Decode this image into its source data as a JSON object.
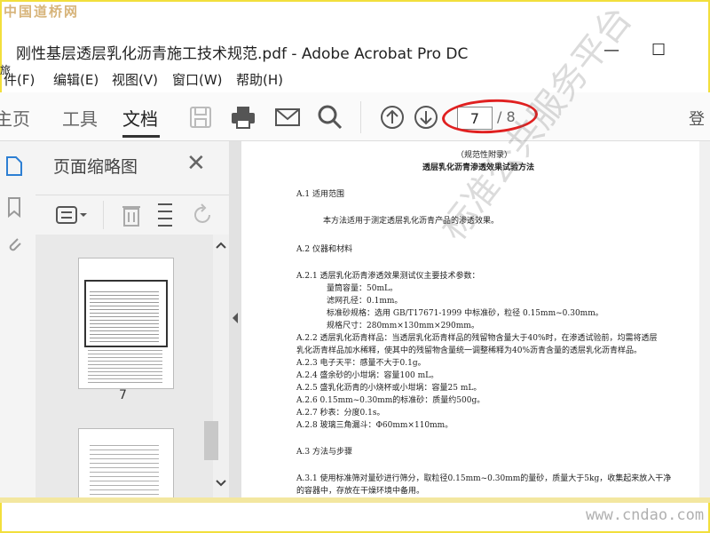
{
  "watermark_top": "中国道桥网",
  "window": {
    "title": "刚性基层透层乳化沥青施工技术规范.pdf - Adobe Acrobat Pro DC",
    "minimize": "—",
    "maximize": "☐"
  },
  "left_fragment": "旅",
  "menu": [
    "件(F)",
    "编辑(E)",
    "视图(V)",
    "窗口(W)",
    "帮助(H)"
  ],
  "tabs": [
    "主页",
    "工具",
    "文档"
  ],
  "pagination": {
    "current": "7",
    "total": "/ 8"
  },
  "right_fragment": "登",
  "panel": {
    "title": "页面缩略图",
    "close": "✕"
  },
  "thumbnail_label": "7",
  "doc_lines": [
    "（规范性附录）",
    "透层乳化沥青渗透效果试验方法",
    "A.1  适用范围",
    "本方法适用于测定透层乳化沥青产品的渗透效果。",
    "A.2  仪器和材料",
    "A.2.1  透层乳化沥青渗透效果测试仪主要技术参数：",
    "量筒容量：50mL。",
    "滤网孔径：0.1mm。",
    "标准砂规格：选用 GB/T17671-1999 中标准砂，粒径 0.15mm~0.30mm。",
    "规格尺寸：280mm×130mm×290mm。",
    "A.2.2  透层乳化沥青样品：当透层乳化沥青样品的残留物含量大于40%时，在渗透试验前，均需将透层",
    "乳化沥青样品加水稀释，使其中的残留物含量统一调整稀释为40%沥青含量的透层乳化沥青样品。",
    "A.2.3  电子天平：感量不大于0.1g。",
    "A.2.4  盛余砂的小坩埚：容量100 mL。",
    "A.2.5  盛乳化沥青的小烧杯或小坩埚：容量25 mL。",
    "A.2.6  0.15mm~0.30mm的标准砂：质量约500g。",
    "A.2.7  秒表：分度0.1s。",
    "A.2.8  玻璃三角漏斗：Φ60mm×110mm。",
    "A.3  方法与步骤",
    "A.3.1  使用标准筛对量砂进行筛分，取粒径0.15mm~0.30mm的量砂，质量大于5kg，收集起来放入干净",
    "的容器中，存放在干燥环境中备用。"
  ],
  "doc_watermark": "标准公共服务平台",
  "bottom_watermark": "www.cndao.com",
  "colors": {
    "frame": "#f2df3c",
    "annotation_oval": "#e02020"
  }
}
